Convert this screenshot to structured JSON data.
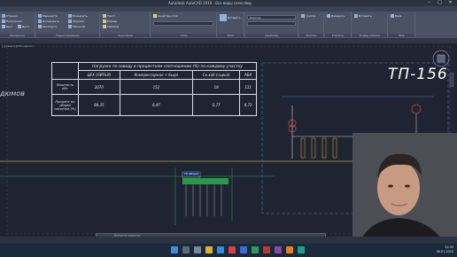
{
  "titlebar": {
    "title": "Autodesk AutoCAD 2019 · Все виды схем.dwg",
    "min": "–",
    "max": "□",
    "close": "✕"
  },
  "menu_tabs": [
    "Главная",
    "Вставка",
    "Аннотации",
    "Параметризация",
    "Вид",
    "Управление",
    "Вывод",
    "Надстройки",
    "Совместная работа",
    "Express Tools",
    "Лучшие приложения"
  ],
  "ribbon": {
    "groups": [
      {
        "label": "Рисование",
        "buttons": [
          "Отрезок",
          "Полилиния",
          "Круг",
          "Дуга"
        ]
      },
      {
        "label": "Редактирование",
        "buttons": [
          "Перенести",
          "Копировать",
          "Растянуть",
          "Повернуть",
          "Зеркало",
          "Масштаб"
        ]
      },
      {
        "label": "Аннотации",
        "buttons": [
          "Текст",
          "Размер",
          "Таблица"
        ]
      },
      {
        "label": "Слои",
        "buttons": [
          "Свойства слоя"
        ]
      },
      {
        "label": "Блок",
        "buttons": [
          "Вставить"
        ]
      },
      {
        "label": "Свойства",
        "buttons": [
          "ПоСлою"
        ]
      },
      {
        "label": "Группы",
        "buttons": [
          "Группа"
        ]
      },
      {
        "label": "Утилиты",
        "buttons": [
          "Измерить"
        ]
      },
      {
        "label": "Буфер обмена",
        "buttons": [
          "Вставить"
        ]
      },
      {
        "label": "Вид",
        "buttons": [
          "База"
        ]
      }
    ]
  },
  "doc_tabs": [
    "Начало",
    "Все виды схем*",
    "Линия РЗ...",
    "ТП-3",
    "Все виды схем.dwg"
  ],
  "view_controls": "[-][Сверху][2D-каркас]",
  "drawing": {
    "left_text": "дюмов",
    "big_label": "ТП-156",
    "table": {
      "header": "Нагрузка по заводу в процентном соотношении (%) по каждому участку",
      "columns": [
        "ЦЕХ (ЛИТЬЯ)",
        "Компрессорная + быдл",
        "Ск.хоб (сырьё)",
        "АБК"
      ],
      "rows": [
        {
          "label": "Мощность кВт",
          "values": [
            "2070",
            "152",
            "18",
            "111"
          ]
        },
        {
          "label": "Процент по общей нагрузке (%)",
          "values": [
            "88,35",
            "6,47",
            "0,77",
            "4,72"
          ]
        }
      ]
    },
    "tp_label": "ТП Объект"
  },
  "command_line": "Введите команду",
  "statusbar": {
    "model": "Модель",
    "layouts": [
      "Лист1",
      "Лист2"
    ],
    "scale": "МОДЕЛЬ"
  },
  "taskbar": {
    "time": "12:35",
    "date": "06.01.2022"
  }
}
